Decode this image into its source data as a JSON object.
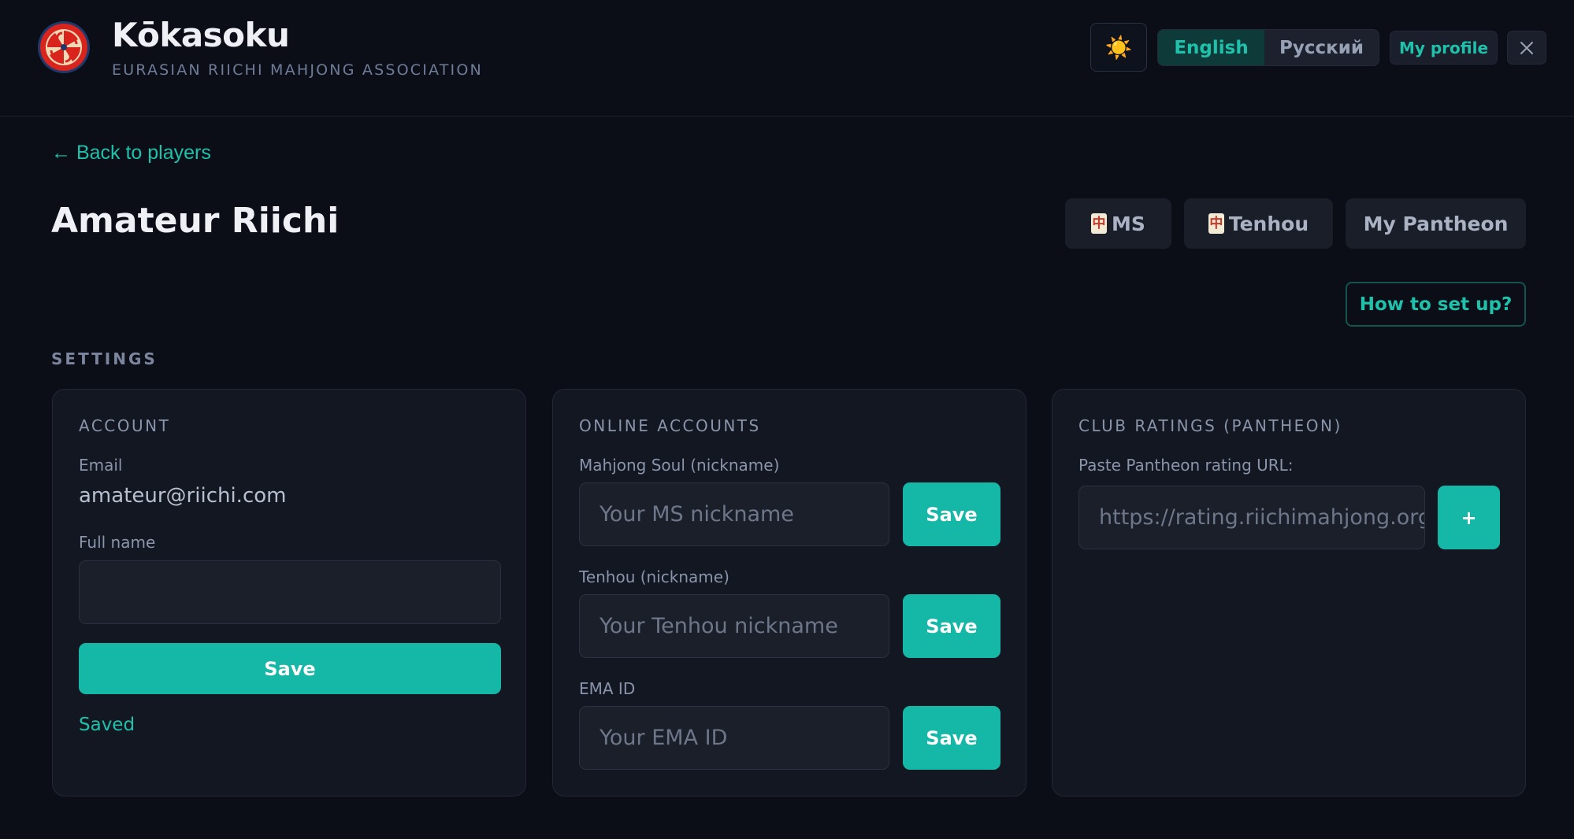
{
  "header": {
    "brand_title": "Kōkasoku",
    "brand_subtitle": "EURASIAN RIICHI MAHJONG ASSOCIATION",
    "theme_icon": "sun-icon",
    "theme_glyph": "☀️",
    "languages": [
      "English",
      "Русский"
    ],
    "active_language": "English",
    "profile_label": "My profile",
    "close_icon": "close-icon"
  },
  "main": {
    "back_link": "← Back to players",
    "title": "Amateur Riichi",
    "chips": {
      "ms": "MS",
      "tenhou": "Tenhou",
      "pantheon": "My Pantheon",
      "tile_glyph": "中"
    },
    "howto_label": "How to set up?",
    "section_label": "SETTINGS"
  },
  "account": {
    "title": "ACCOUNT",
    "email_label": "Email",
    "email_value": "amateur@riichi.com",
    "fullname_label": "Full name",
    "fullname_value": "",
    "save_label": "Save",
    "status": "Saved"
  },
  "online": {
    "title": "ONLINE ACCOUNTS",
    "ms_label": "Mahjong Soul (nickname)",
    "ms_placeholder": "Your MS nickname",
    "tenhou_label": "Tenhou (nickname)",
    "tenhou_placeholder": "Your Tenhou nickname",
    "ema_label": "EMA ID",
    "ema_placeholder": "Your EMA ID",
    "save_label": "Save"
  },
  "club": {
    "title": "CLUB RATINGS (PANTHEON)",
    "url_label": "Paste Pantheon rating URL:",
    "url_placeholder": "https://rating.riichimahjong.org",
    "add_label": "+"
  },
  "colors": {
    "accent": "#15b7a7",
    "accent_text": "#1fc1aa",
    "background": "#0b0e17",
    "card": "#131722"
  }
}
